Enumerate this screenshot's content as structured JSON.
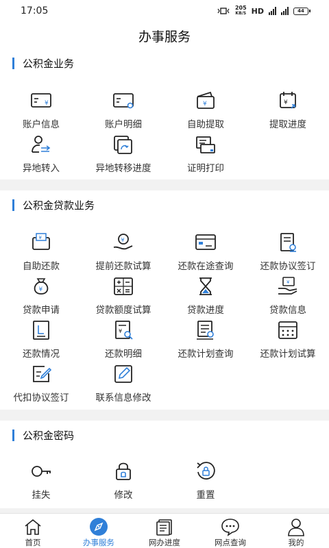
{
  "status": {
    "time": "17:05",
    "speed_value": "205",
    "speed_unit": "KB/S",
    "hd": "HD",
    "battery": "44"
  },
  "header": {
    "title": "办事服务"
  },
  "sections": [
    {
      "title": "公积金业务",
      "items": [
        {
          "label": "账户信息",
          "icon": "account-card-icon"
        },
        {
          "label": "账户明细",
          "icon": "account-detail-icon"
        },
        {
          "label": "自助提取",
          "icon": "wallet-icon"
        },
        {
          "label": "提取进度",
          "icon": "calendar-progress-icon"
        },
        {
          "label": "异地转入",
          "icon": "user-transfer-icon"
        },
        {
          "label": "异地转移进度",
          "icon": "transfer-progress-icon"
        },
        {
          "label": "证明打印",
          "icon": "printer-icon"
        }
      ]
    },
    {
      "title": "公积金贷款业务",
      "items": [
        {
          "label": "自助还款",
          "icon": "wallet-repay-icon"
        },
        {
          "label": "提前还款试算",
          "icon": "hand-coin-icon"
        },
        {
          "label": "还款在途查询",
          "icon": "card-window-icon"
        },
        {
          "label": "还款协议签订",
          "icon": "document-sign-icon"
        },
        {
          "label": "贷款申请",
          "icon": "money-bag-icon"
        },
        {
          "label": "贷款额度试算",
          "icon": "calculator-icon"
        },
        {
          "label": "贷款进度",
          "icon": "hourglass-icon"
        },
        {
          "label": "贷款信息",
          "icon": "hand-card-icon"
        },
        {
          "label": "还款情况",
          "icon": "report-icon"
        },
        {
          "label": "还款明细",
          "icon": "document-search-icon"
        },
        {
          "label": "还款计划查询",
          "icon": "list-search-icon"
        },
        {
          "label": "还款计划试算",
          "icon": "calendar-grid-icon"
        },
        {
          "label": "代扣协议签订",
          "icon": "edit-document-icon"
        },
        {
          "label": "联系信息修改",
          "icon": "pencil-box-icon"
        }
      ]
    },
    {
      "title": "公积金密码",
      "items": [
        {
          "label": "挂失",
          "icon": "key-icon"
        },
        {
          "label": "修改",
          "icon": "lock-icon"
        },
        {
          "label": "重置",
          "icon": "reset-lock-icon"
        }
      ]
    }
  ],
  "tabs": [
    {
      "label": "首页",
      "icon": "home-icon",
      "active": false
    },
    {
      "label": "办事服务",
      "icon": "compass-icon",
      "active": true
    },
    {
      "label": "网办进度",
      "icon": "progress-doc-icon",
      "active": false
    },
    {
      "label": "网点查询",
      "icon": "chat-bubble-icon",
      "active": false
    },
    {
      "label": "我的",
      "icon": "person-icon",
      "active": false
    }
  ],
  "colors": {
    "accent": "#2f7fd8",
    "icon_dark": "#222222",
    "background": "#f2f2f2"
  }
}
